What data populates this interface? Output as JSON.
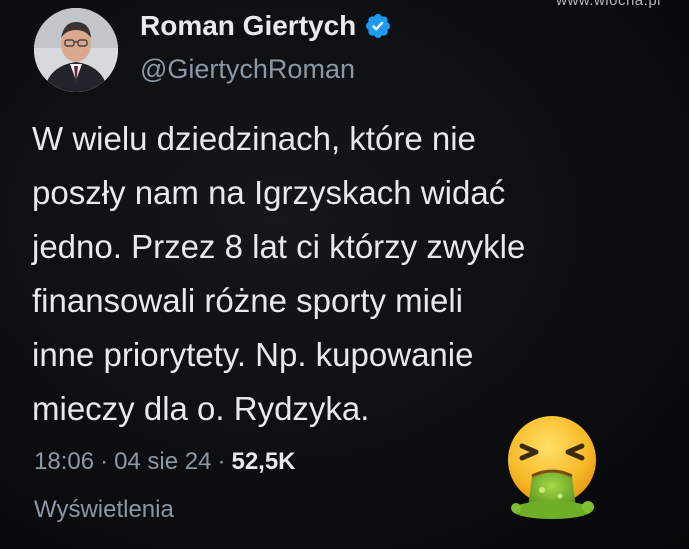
{
  "watermark": "www.wiocha.pl",
  "author": {
    "name": "Roman Giertych",
    "handle": "@GiertychRoman",
    "verified": true,
    "verified_icon": "verified-badge-icon",
    "verified_color": "#1d9bf0"
  },
  "tweet": {
    "text": "W wielu dziedzinach, które nie\nposzły nam na Igrzyskach widać\njedno. Przez 8 lat ci którzy zwykle\nfinansowali różne sporty mieli\ninne priorytety. Np. kupowanie\nmieczy dla o. Rydzyka."
  },
  "meta": {
    "time": "18:06",
    "separator": "·",
    "date": "04 sie 24",
    "views": "52,5K",
    "views_label": "Wyświetlenia"
  },
  "overlay": {
    "emoji": "face-vomiting-icon"
  }
}
